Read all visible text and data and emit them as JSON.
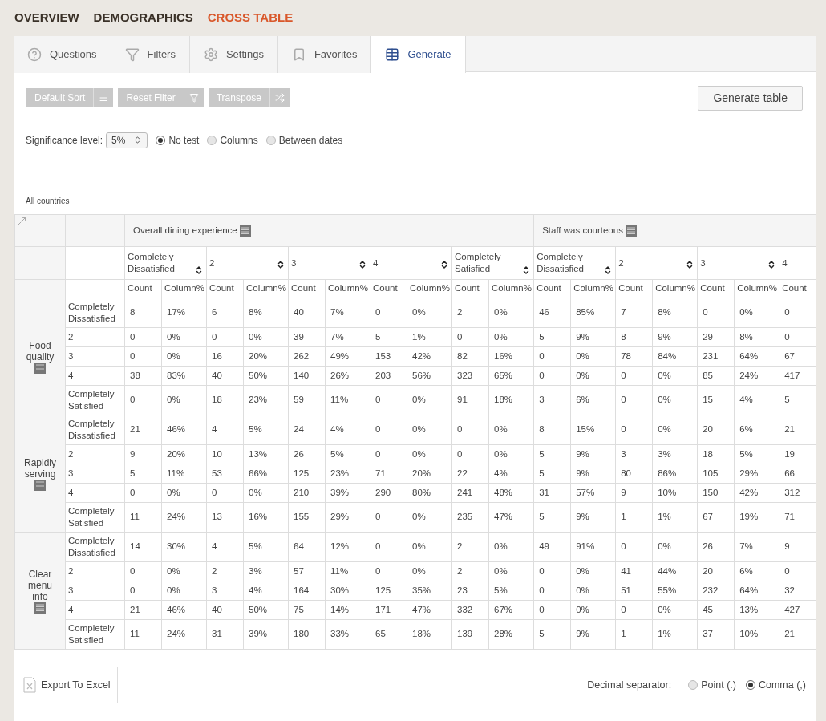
{
  "nav": [
    {
      "label": "OVERVIEW",
      "selected": false
    },
    {
      "label": "DEMOGRAPHICS",
      "selected": false
    },
    {
      "label": "CROSS TABLE",
      "selected": true
    }
  ],
  "tabs": [
    {
      "label": "Questions",
      "kind": "help",
      "selected": false
    },
    {
      "label": "Filters",
      "kind": "filter",
      "selected": false
    },
    {
      "label": "Settings",
      "kind": "settings",
      "selected": false
    },
    {
      "label": "Favorites",
      "kind": "bookmark",
      "selected": false
    },
    {
      "label": "Generate",
      "kind": "table",
      "selected": true
    }
  ],
  "toolbar": {
    "buttons": [
      {
        "label": "Default Sort",
        "kind": "sort",
        "disabled": true
      },
      {
        "label": "Reset Filter",
        "kind": "filter",
        "disabled": true
      },
      {
        "label": "Transpose",
        "kind": "shuffle",
        "disabled": true
      }
    ],
    "generate_button": "Generate table"
  },
  "significance": {
    "label": "Significance level:",
    "value": "5%",
    "tests": [
      {
        "label": "No test",
        "selected": true
      },
      {
        "label": "Columns",
        "selected": false
      },
      {
        "label": "Between dates",
        "selected": false
      }
    ]
  },
  "table": {
    "caption": "All countries",
    "groups": [
      {
        "title": "Overall dining experience",
        "options": [
          {
            "label": "Completely Dissatisfied",
            "measures": [
              "Count",
              "Column%"
            ]
          },
          {
            "label": "2",
            "measures": [
              "Count",
              "Column%"
            ]
          },
          {
            "label": "3",
            "measures": [
              "Count",
              "Column%"
            ]
          },
          {
            "label": "4",
            "measures": [
              "Count",
              "Column%"
            ]
          },
          {
            "label": "Completely Satisfied",
            "measures": [
              "Count",
              "Column%"
            ]
          }
        ]
      },
      {
        "title": "Staff was courteous",
        "options": [
          {
            "label": "Completely Dissatisfied",
            "measures": [
              "Count",
              "Column%"
            ]
          },
          {
            "label": "2",
            "measures": [
              "Count",
              "Column%"
            ]
          },
          {
            "label": "3",
            "measures": [
              "Count",
              "Column%"
            ]
          },
          {
            "label": "4",
            "measures": [
              "Count"
            ]
          }
        ]
      }
    ],
    "row_groups": [
      {
        "label": "Food quality",
        "rows": [
          {
            "label": "Completely Dissatisfied",
            "cells": [
              "8",
              "17%",
              "6",
              "8%",
              "40",
              "7%",
              "0",
              "0%",
              "2",
              "0%",
              "46",
              "85%",
              "7",
              "8%",
              "0",
              "0%",
              "0"
            ]
          },
          {
            "label": "2",
            "cells": [
              "0",
              "0%",
              "0",
              "0%",
              "39",
              "7%",
              "5",
              "1%",
              "0",
              "0%",
              "5",
              "9%",
              "8",
              "9%",
              "29",
              "8%",
              "0"
            ]
          },
          {
            "label": "3",
            "cells": [
              "0",
              "0%",
              "16",
              "20%",
              "262",
              "49%",
              "153",
              "42%",
              "82",
              "16%",
              "0",
              "0%",
              "78",
              "84%",
              "231",
              "64%",
              "67"
            ]
          },
          {
            "label": "4",
            "cells": [
              "38",
              "83%",
              "40",
              "50%",
              "140",
              "26%",
              "203",
              "56%",
              "323",
              "65%",
              "0",
              "0%",
              "0",
              "0%",
              "85",
              "24%",
              "417"
            ]
          },
          {
            "label": "Completely Satisfied",
            "cells": [
              "0",
              "0%",
              "18",
              "23%",
              "59",
              "11%",
              "0",
              "0%",
              "91",
              "18%",
              "3",
              "6%",
              "0",
              "0%",
              "15",
              "4%",
              "5"
            ]
          }
        ]
      },
      {
        "label": "Rapidly serving",
        "rows": [
          {
            "label": "Completely Dissatisfied",
            "cells": [
              "21",
              "46%",
              "4",
              "5%",
              "24",
              "4%",
              "0",
              "0%",
              "0",
              "0%",
              "8",
              "15%",
              "0",
              "0%",
              "20",
              "6%",
              "21"
            ]
          },
          {
            "label": "2",
            "cells": [
              "9",
              "20%",
              "10",
              "13%",
              "26",
              "5%",
              "0",
              "0%",
              "0",
              "0%",
              "5",
              "9%",
              "3",
              "3%",
              "18",
              "5%",
              "19"
            ]
          },
          {
            "label": "3",
            "cells": [
              "5",
              "11%",
              "53",
              "66%",
              "125",
              "23%",
              "71",
              "20%",
              "22",
              "4%",
              "5",
              "9%",
              "80",
              "86%",
              "105",
              "29%",
              "66"
            ]
          },
          {
            "label": "4",
            "cells": [
              "0",
              "0%",
              "0",
              "0%",
              "210",
              "39%",
              "290",
              "80%",
              "241",
              "48%",
              "31",
              "57%",
              "9",
              "10%",
              "150",
              "42%",
              "312"
            ]
          },
          {
            "label": "Completely Satisfied",
            "cells": [
              "11",
              "24%",
              "13",
              "16%",
              "155",
              "29%",
              "0",
              "0%",
              "235",
              "47%",
              "5",
              "9%",
              "1",
              "1%",
              "67",
              "19%",
              "71"
            ]
          }
        ]
      },
      {
        "label": "Clear menu info",
        "rows": [
          {
            "label": "Completely Dissatisfied",
            "cells": [
              "14",
              "30%",
              "4",
              "5%",
              "64",
              "12%",
              "0",
              "0%",
              "2",
              "0%",
              "49",
              "91%",
              "0",
              "0%",
              "26",
              "7%",
              "9"
            ]
          },
          {
            "label": "2",
            "cells": [
              "0",
              "0%",
              "2",
              "3%",
              "57",
              "11%",
              "0",
              "0%",
              "2",
              "0%",
              "0",
              "0%",
              "41",
              "44%",
              "20",
              "6%",
              "0"
            ]
          },
          {
            "label": "3",
            "cells": [
              "0",
              "0%",
              "3",
              "4%",
              "164",
              "30%",
              "125",
              "35%",
              "23",
              "5%",
              "0",
              "0%",
              "51",
              "55%",
              "232",
              "64%",
              "32"
            ]
          },
          {
            "label": "4",
            "cells": [
              "21",
              "46%",
              "40",
              "50%",
              "75",
              "14%",
              "171",
              "47%",
              "332",
              "67%",
              "0",
              "0%",
              "0",
              "0%",
              "45",
              "13%",
              "427"
            ]
          },
          {
            "label": "Completely Satisfied",
            "cells": [
              "11",
              "24%",
              "31",
              "39%",
              "180",
              "33%",
              "65",
              "18%",
              "139",
              "28%",
              "5",
              "9%",
              "1",
              "1%",
              "37",
              "10%",
              "21"
            ]
          }
        ]
      }
    ]
  },
  "footer": {
    "export": "Export To Excel",
    "decimal_label": "Decimal separator:",
    "decimal_options": [
      {
        "label": "Point (.)",
        "selected": false
      },
      {
        "label": "Comma (,)",
        "selected": true
      }
    ]
  }
}
